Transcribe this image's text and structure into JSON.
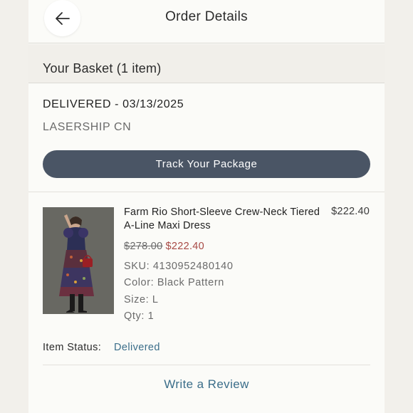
{
  "header": {
    "title": "Order Details",
    "back_icon": "arrow-left-icon"
  },
  "basket": {
    "title": "Your Basket (1 item)"
  },
  "delivery": {
    "status": "DELIVERED - 03/13/2025",
    "carrier": "LASERSHIP CN",
    "track_button_label": "Track Your Package"
  },
  "item": {
    "name": "Farm Rio Short-Sleeve Crew-Neck Tiered A-Line Maxi Dress",
    "price": "$222.40",
    "original_price": "$278.00",
    "sale_price": "$222.40",
    "sku": "SKU: 4130952480140",
    "color": "Color: Black Pattern",
    "size": "Size: L",
    "qty": "Qty: 1",
    "status_label": "Item Status:",
    "status_value": "Delivered",
    "review_link": "Write a Review"
  },
  "colors": {
    "accent": "#3b6e8a",
    "button": "#4a5565",
    "sale": "#a84a45"
  }
}
